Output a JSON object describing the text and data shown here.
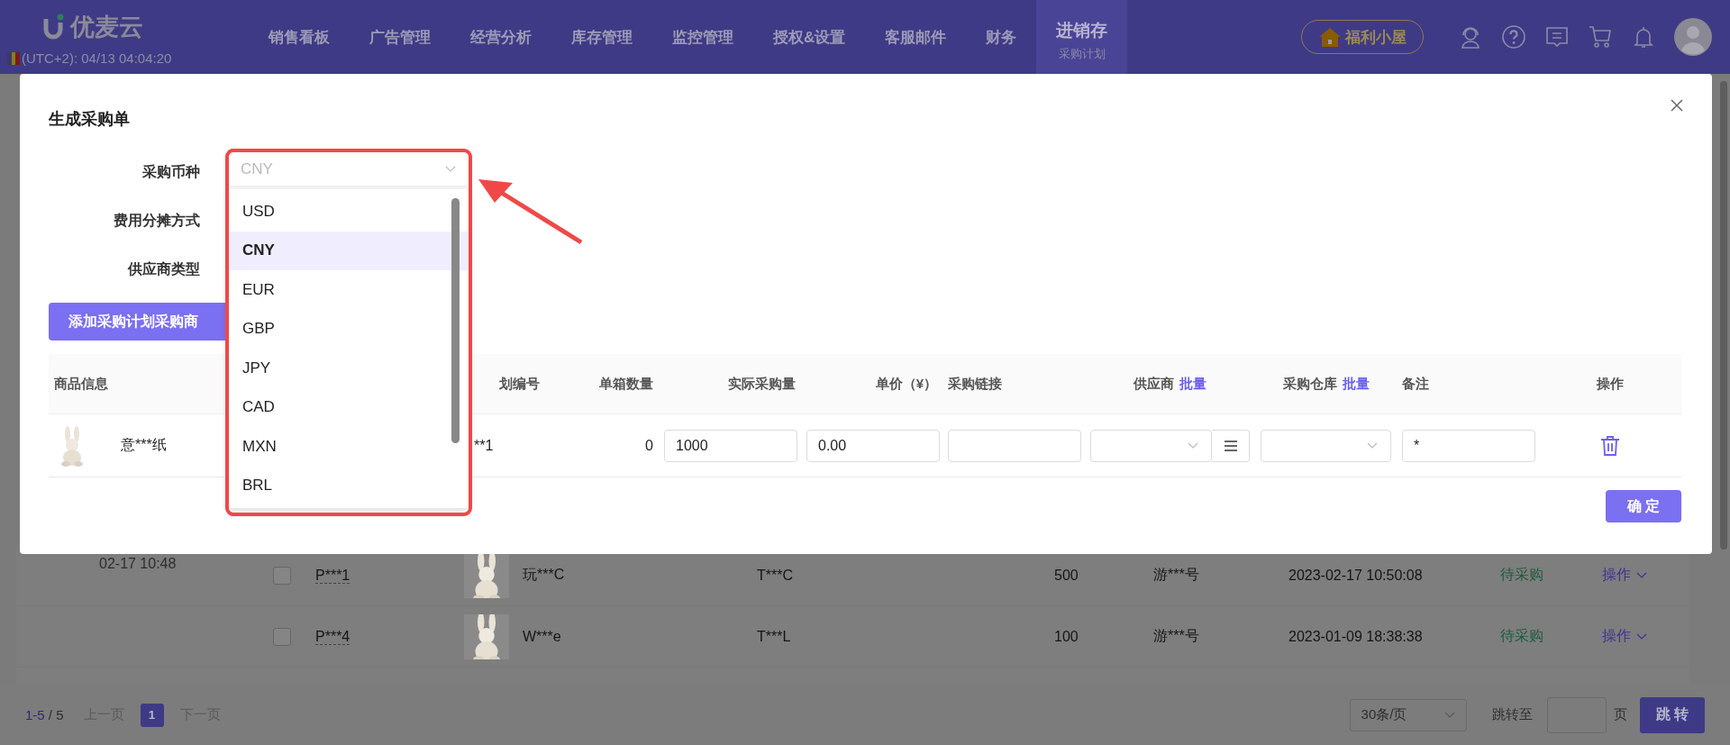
{
  "nav": {
    "logo": "优麦云",
    "timezone": "(UTC+2): 04/13 04:04:20",
    "items": [
      {
        "label": "销售看板",
        "selected": false
      },
      {
        "label": "广告管理",
        "selected": false
      },
      {
        "label": "经营分析",
        "selected": false
      },
      {
        "label": "库存管理",
        "selected": false
      },
      {
        "label": "监控管理",
        "selected": false
      },
      {
        "label": "授权&设置",
        "selected": false
      },
      {
        "label": "客服邮件",
        "selected": false
      },
      {
        "label": "财务",
        "selected": false
      },
      {
        "label": "进销存",
        "sub": "采购计划",
        "selected": true
      }
    ],
    "welfare_button": "福利小屋"
  },
  "background_table": {
    "group_time": "02-17 10:48",
    "rows": [
      {
        "checked": false,
        "order": "P***1",
        "product": "玩***C",
        "column_5": "T***C",
        "quantity": "500",
        "supplier": "游***号",
        "time": "2023-02-17 10:50:08",
        "status": "待采购",
        "action": "操作"
      },
      {
        "checked": false,
        "order": "P***4",
        "product": "W***e",
        "column_5": "T***L",
        "quantity": "100",
        "supplier": "游***号",
        "time": "2023-01-09 18:38:38",
        "status": "待采购",
        "action": "操作"
      }
    ]
  },
  "pagination": {
    "range": "1-5",
    "separator": "/",
    "total": "5",
    "prev": "上一页",
    "pages": [
      {
        "label": "1",
        "selected": true
      }
    ],
    "next": "下一页",
    "page_size": "30条/页",
    "jump_label": "跳转至",
    "jump_unit": "页",
    "jump_button": "跳 转"
  },
  "modal": {
    "title": "生成采购单",
    "fields": [
      {
        "label": "采购币种"
      },
      {
        "label": "费用分摊方式"
      },
      {
        "label": "供应商类型"
      }
    ],
    "currency_select": {
      "value": "CNY",
      "options": [
        {
          "label": "USD",
          "selected": false
        },
        {
          "label": "CNY",
          "selected": true
        },
        {
          "label": "EUR",
          "selected": false
        },
        {
          "label": "GBP",
          "selected": false
        },
        {
          "label": "JPY",
          "selected": false
        },
        {
          "label": "CAD",
          "selected": false
        },
        {
          "label": "MXN",
          "selected": false
        },
        {
          "label": "BRL",
          "selected": false
        }
      ]
    },
    "add_button": "添加采购计划采购商",
    "table": {
      "columns": [
        {
          "label": "商品信息"
        },
        {
          "label": "划编号"
        },
        {
          "label": "单箱数量"
        },
        {
          "label": "实际采购量"
        },
        {
          "label": "单价（¥）"
        },
        {
          "label": "采购链接"
        },
        {
          "label": "供应商",
          "link": "批量"
        },
        {
          "label": "采购仓库",
          "link": "批量"
        },
        {
          "label": "备注"
        },
        {
          "label": "操作"
        }
      ],
      "rows": [
        {
          "product": "意***纸",
          "plan_no": "**1",
          "per_box": "0",
          "actual_qty": "1000",
          "unit_price": "0.00",
          "remark": "*"
        }
      ]
    },
    "confirm_button": "确 定"
  }
}
